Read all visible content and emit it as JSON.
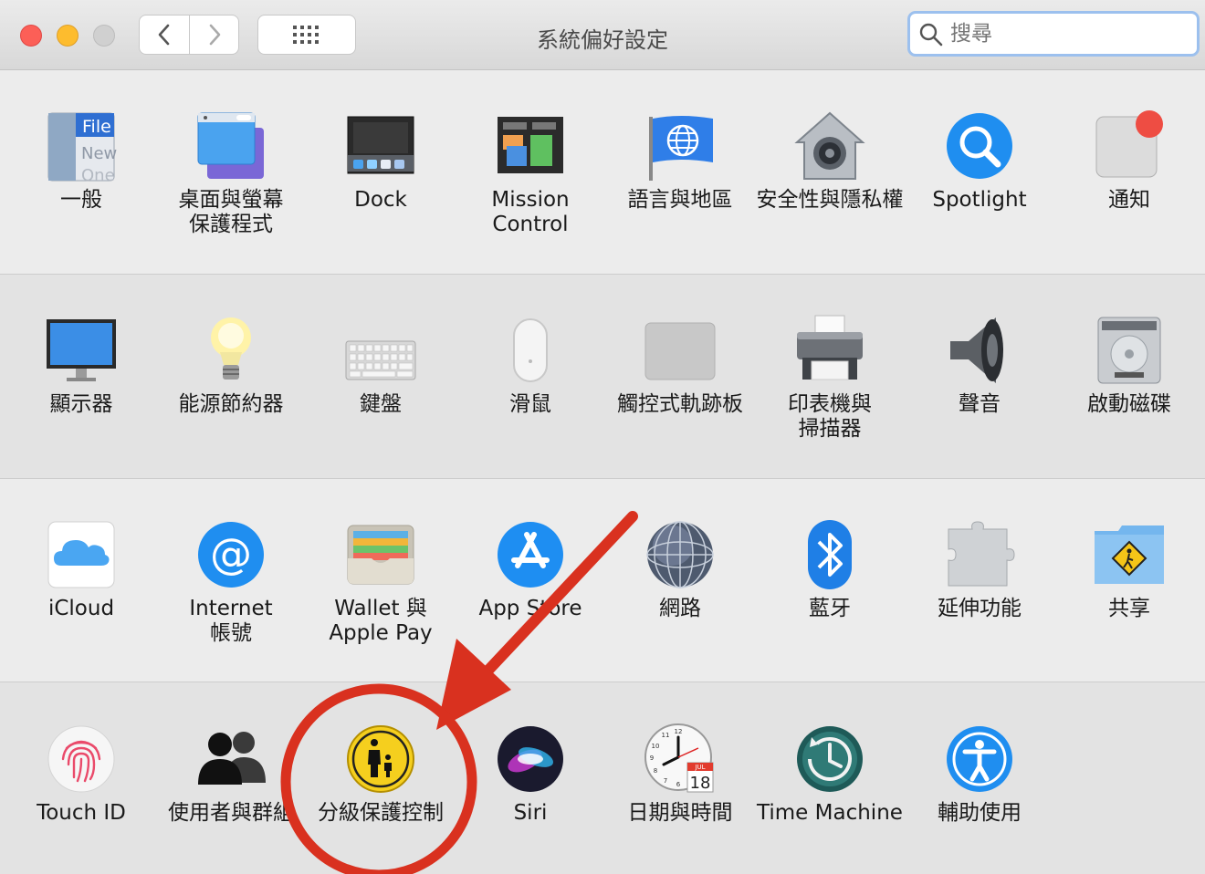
{
  "window": {
    "title": "系統偏好設定"
  },
  "toolbar": {
    "back_icon": "chevron-left-icon",
    "forward_icon": "chevron-right-icon",
    "grid_icon": "grid-icon",
    "search_placeholder": "搜尋"
  },
  "rows": [
    {
      "items": [
        {
          "label": "一般",
          "icon": "general-icon"
        },
        {
          "label": "桌面與螢幕\n保護程式",
          "icon": "desktop-screensaver-icon"
        },
        {
          "label": "Dock",
          "icon": "dock-icon"
        },
        {
          "label": "Mission\nControl",
          "icon": "mission-control-icon"
        },
        {
          "label": "語言與地區",
          "icon": "language-region-icon"
        },
        {
          "label": "安全性與隱私權",
          "icon": "security-privacy-icon"
        },
        {
          "label": "Spotlight",
          "icon": "spotlight-icon"
        },
        {
          "label": "通知",
          "icon": "notifications-icon"
        }
      ]
    },
    {
      "items": [
        {
          "label": "顯示器",
          "icon": "displays-icon"
        },
        {
          "label": "能源節約器",
          "icon": "energy-saver-icon"
        },
        {
          "label": "鍵盤",
          "icon": "keyboard-icon"
        },
        {
          "label": "滑鼠",
          "icon": "mouse-icon"
        },
        {
          "label": "觸控式軌跡板",
          "icon": "trackpad-icon"
        },
        {
          "label": "印表機與\n掃描器",
          "icon": "printers-scanners-icon"
        },
        {
          "label": "聲音",
          "icon": "sound-icon"
        },
        {
          "label": "啟動磁碟",
          "icon": "startup-disk-icon"
        }
      ]
    },
    {
      "items": [
        {
          "label": "iCloud",
          "icon": "icloud-icon"
        },
        {
          "label": "Internet\n帳號",
          "icon": "internet-accounts-icon"
        },
        {
          "label": "Wallet 與\nApple Pay",
          "icon": "wallet-applepay-icon"
        },
        {
          "label": "App Store",
          "icon": "app-store-icon"
        },
        {
          "label": "網路",
          "icon": "network-icon"
        },
        {
          "label": "藍牙",
          "icon": "bluetooth-icon"
        },
        {
          "label": "延伸功能",
          "icon": "extensions-icon"
        },
        {
          "label": "共享",
          "icon": "sharing-icon"
        }
      ]
    },
    {
      "items": [
        {
          "label": "Touch ID",
          "icon": "touch-id-icon"
        },
        {
          "label": "使用者與群組",
          "icon": "users-groups-icon"
        },
        {
          "label": "分級保護控制",
          "icon": "parental-controls-icon"
        },
        {
          "label": "Siri",
          "icon": "siri-icon"
        },
        {
          "label": "日期與時間",
          "icon": "date-time-icon"
        },
        {
          "label": "Time Machine",
          "icon": "time-machine-icon"
        },
        {
          "label": "輔助使用",
          "icon": "accessibility-icon"
        }
      ]
    }
  ],
  "calendar_icon": {
    "month": "JUL",
    "day": "18"
  },
  "clock_numerals": [
    "12",
    "11",
    "10",
    "9",
    "8",
    "7",
    "6"
  ],
  "annotation": {
    "color": "#d9311f",
    "target": "分級保護控制"
  }
}
